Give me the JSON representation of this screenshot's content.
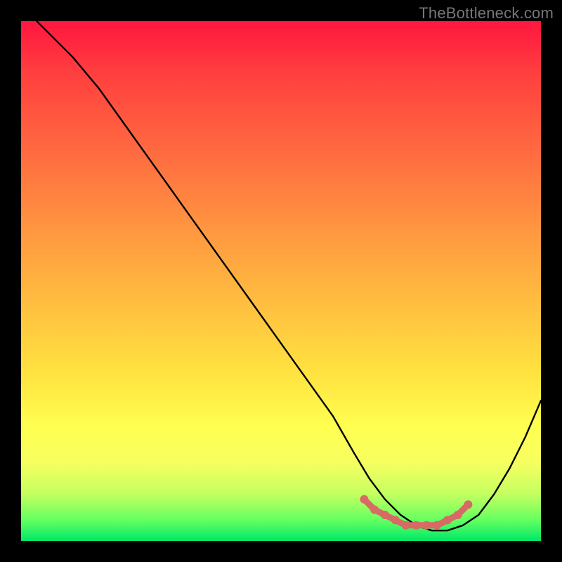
{
  "watermark": "TheBottleneck.com",
  "chart_data": {
    "type": "line",
    "title": "",
    "xlabel": "",
    "ylabel": "",
    "xlim": [
      0,
      100
    ],
    "ylim": [
      0,
      100
    ],
    "grid": false,
    "series": [
      {
        "name": "curve",
        "color": "#000000",
        "x": [
          3,
          6,
          10,
          15,
          20,
          25,
          30,
          35,
          40,
          45,
          50,
          55,
          60,
          64,
          67,
          70,
          73,
          76,
          79,
          82,
          85,
          88,
          91,
          94,
          97,
          100
        ],
        "values": [
          100,
          97,
          93,
          87,
          80,
          73,
          66,
          59,
          52,
          45,
          38,
          31,
          24,
          17,
          12,
          8,
          5,
          3,
          2,
          2,
          3,
          5,
          9,
          14,
          20,
          27
        ]
      },
      {
        "name": "highlight-dots",
        "color": "#d86a66",
        "x": [
          66,
          68,
          70,
          72,
          74,
          76,
          78,
          80,
          82,
          84,
          86
        ],
        "values": [
          8,
          6,
          5,
          4,
          3,
          3,
          3,
          3,
          4,
          5,
          7
        ]
      }
    ],
    "gradient_stops": [
      {
        "pos": 0,
        "color": "#ff163f"
      },
      {
        "pos": 25,
        "color": "#ff6a40"
      },
      {
        "pos": 55,
        "color": "#ffc040"
      },
      {
        "pos": 78,
        "color": "#ffff50"
      },
      {
        "pos": 100,
        "color": "#00e868"
      }
    ]
  }
}
